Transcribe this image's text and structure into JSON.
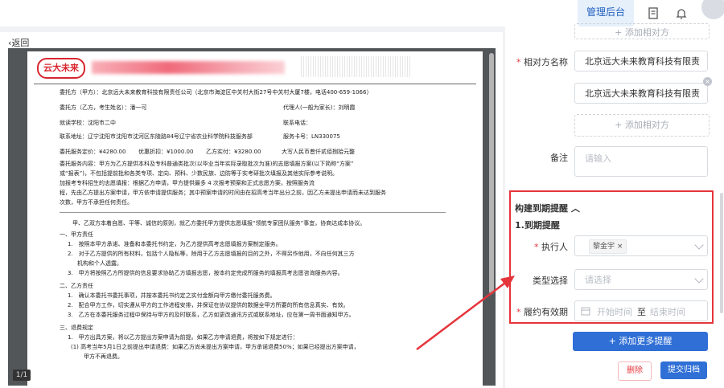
{
  "header": {
    "admin_label": "管理后台",
    "icons": [
      "document-icon",
      "bell-icon",
      "avatar"
    ]
  },
  "nav": {
    "back_label": "返回"
  },
  "viewer": {
    "page_indicator": "1/1"
  },
  "document": {
    "logo_text": "云大未来",
    "lines": [
      "委托方（甲方）：北京远大未来教育科技有限责任公司（北京市海淀区中关村大街27号中关村大厦7楼，电话400-659-1066）",
      "委托方（乙方，考生姓名）：潘一可",
      "代理人(一般为家长)：刘明霞",
      "就读学校：沈阳市二中",
      "联系电话：",
      "联系地址：辽宁沈阳市沈阳市沈河区东陵路84号辽宁省农业科学院科技服务部",
      "服务卡号：LN330075",
      "委托服务定价：¥4280.00",
      "优惠折扣：¥1000.00",
      "乙方实付：¥3280.00",
      "大写人民币叁仟贰佰捌拾元整",
      "委托服务内容：甲方为乙方提供本科及专科普通类批次(以毕业当年实际录取批次为准)的志愿填报方案(以下简称“方案”",
      "或“报表”)，不包括提前批和各类专项、定向、预科、少数民族、边防等于实考研批次填报及其他实际参考说明。",
      "加报考专科招生的志愿填报：根据乙方申请，甲方提供最多 4 次报考预案和正式志愿方案，按照服务流",
      "程，先由乙方提出方案申请，甲方依申请提供服务；其中预案申请的时间由在招高考当年出分之前，因乙方未提出申请而未达到服务",
      "次数，甲方不承担任何责任。",
      "甲、乙双方本着自愿、平等、诚信的原则，就乙方委托甲方提供志愿填报“领航专家团队服务”事宜，协商达成本协议。",
      "一、甲方责任",
      "1.　按照本甲方承诺、准备和本委托书约定，为乙方提供高考志愿填报方案制定服务。",
      "2.　对于乙方提供的所有材料，包括个人隐私等，除用于乙方志愿填报的目的之外，不得另作他用，不向任何其三方",
      "机构和个人透露。",
      "3.　甲方将按照乙方所提供的信息要求协助乙方填报志愿，按本约定完成所服务的填报高考志愿咨询服务内容。",
      "二、乙方责任",
      "1.　确认本委托书委托事项，并按本委托书约定之实付金额向甲方缴付委托服务费。",
      "2.　配合甲方工作，切实遵从甲方的工作进程安排，并保证在协议提供的数据全甲方所要的所有信息真实、有效。",
      "3.　乙方在本委托服务过程中保持与甲方的及时联系，乙方如更改通讯方式或联系地址，应在第一周书面通知甲方。",
      "三、退费规定",
      "1.　甲方出具方案，将以乙方提出方案申请为前提。如果乙方申请退费，将按如下规定进行：",
      "(1) 高考当年5月1日之前提出申请退费：如果乙方尚未提出方案申请，甲方承诺退费50%；如果已经提出方案申请，",
      "甲方不再退费。"
    ]
  },
  "form": {
    "add_top_label": "+ 添加相对方",
    "counterparty": {
      "label": "相对方名称",
      "values": [
        "北京远大未来教育科技有限责",
        "北京远大未来教育科技有限责"
      ],
      "add_label": "+ 添加相对方"
    },
    "remark": {
      "label": "备注",
      "placeholder": "请输入"
    },
    "reminder": {
      "title": "构建到期提醒",
      "subtitle": "1.到期提醒",
      "executor_label": "执行人",
      "executor_tag": "黎金宇",
      "type_label": "类型选择",
      "type_placeholder": "请选择",
      "period_label": "履约有效期",
      "start_placeholder": "开始时间",
      "separator": "至",
      "end_placeholder": "结束时间",
      "required_mark": "*"
    },
    "add_more_label": "+ 添加更多提醒",
    "delete_label": "删除",
    "submit_label": "提交归档"
  },
  "colors": {
    "accent": "#2f6fd6",
    "danger": "#e5353b",
    "highlight_border": "#e5353b"
  }
}
